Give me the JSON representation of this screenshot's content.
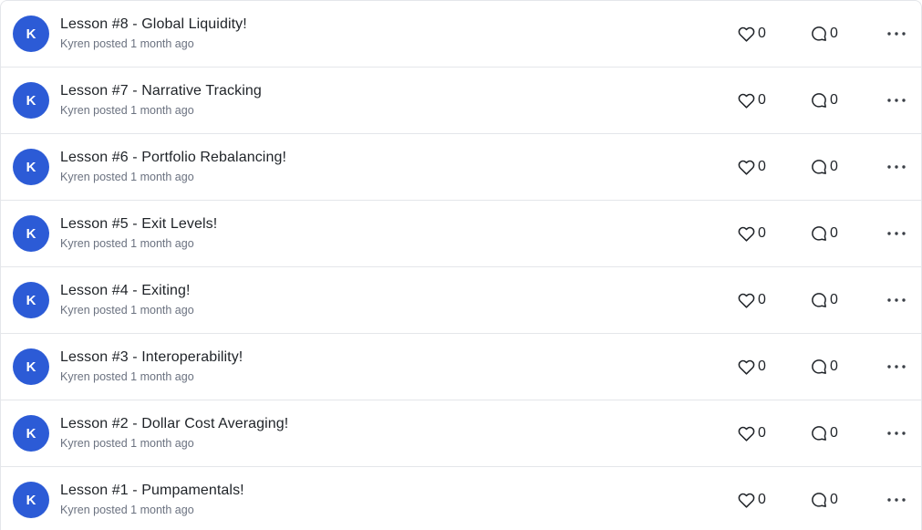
{
  "accent_color": "#2c5bd6",
  "posts": [
    {
      "avatar_initial": "K",
      "title": "Lesson #8 - Global Liquidity!",
      "author": "Kyren",
      "verb": "posted",
      "time": "1 month ago",
      "likes": "0",
      "comments": "0"
    },
    {
      "avatar_initial": "K",
      "title": "Lesson #7 - Narrative Tracking",
      "author": "Kyren",
      "verb": "posted",
      "time": "1 month ago",
      "likes": "0",
      "comments": "0"
    },
    {
      "avatar_initial": "K",
      "title": "Lesson #6 - Portfolio Rebalancing!",
      "author": "Kyren",
      "verb": "posted",
      "time": "1 month ago",
      "likes": "0",
      "comments": "0"
    },
    {
      "avatar_initial": "K",
      "title": "Lesson #5 - Exit Levels!",
      "author": "Kyren",
      "verb": "posted",
      "time": "1 month ago",
      "likes": "0",
      "comments": "0"
    },
    {
      "avatar_initial": "K",
      "title": "Lesson #4 - Exiting!",
      "author": "Kyren",
      "verb": "posted",
      "time": "1 month ago",
      "likes": "0",
      "comments": "0"
    },
    {
      "avatar_initial": "K",
      "title": "Lesson #3 - Interoperability!",
      "author": "Kyren",
      "verb": "posted",
      "time": "1 month ago",
      "likes": "0",
      "comments": "0"
    },
    {
      "avatar_initial": "K",
      "title": "Lesson #2 - Dollar Cost Averaging!",
      "author": "Kyren",
      "verb": "posted",
      "time": "1 month ago",
      "likes": "0",
      "comments": "0"
    },
    {
      "avatar_initial": "K",
      "title": "Lesson #1 - Pumpamentals!",
      "author": "Kyren",
      "verb": "posted",
      "time": "1 month ago",
      "likes": "0",
      "comments": "0"
    }
  ],
  "icons": {
    "like": "heart-icon",
    "comment": "comment-bubble-icon",
    "more": "more-horizontal-icon"
  }
}
